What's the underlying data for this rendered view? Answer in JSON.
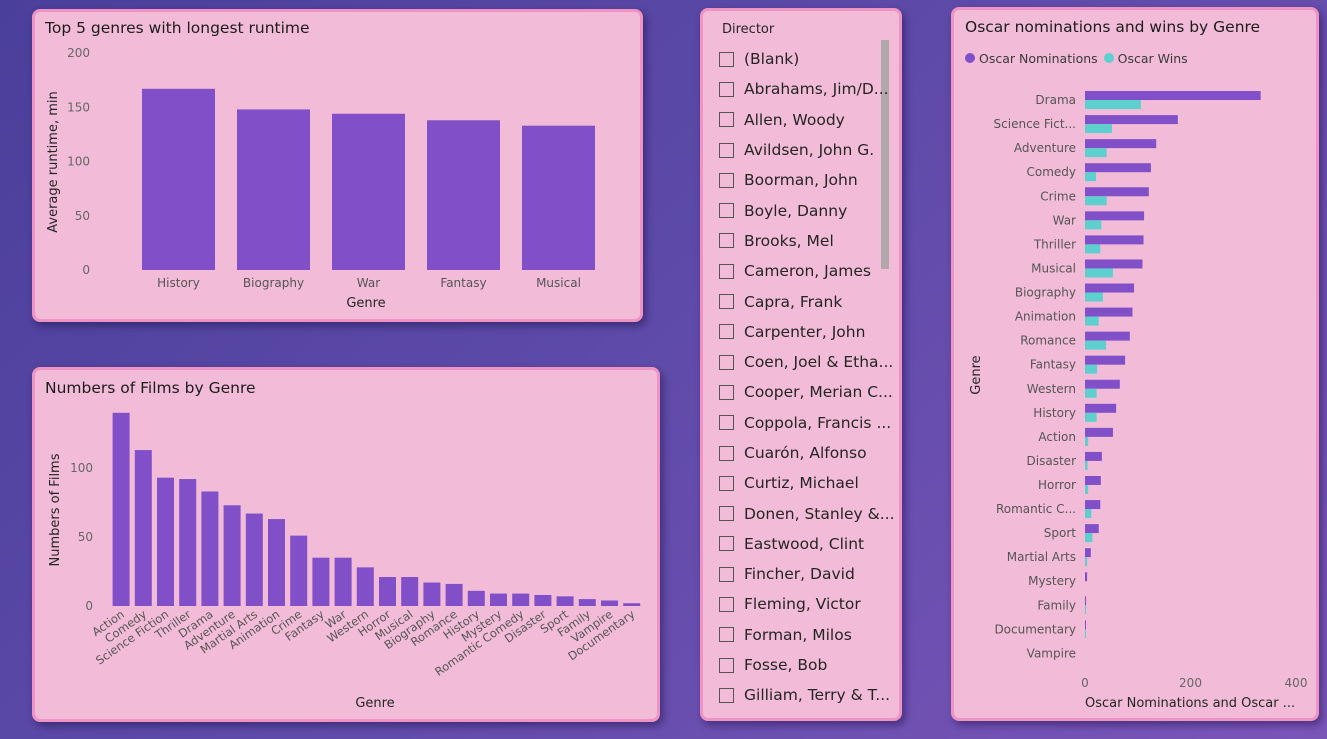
{
  "charts": {
    "runtime": {
      "title": "Top 5 genres with longest runtime",
      "xlabel": "Genre",
      "ylabel": "Average runtime, min",
      "ticks": [
        "0",
        "50",
        "100",
        "150",
        "200"
      ]
    },
    "films": {
      "title": "Numbers of Films by Genre",
      "xlabel": "Genre",
      "ylabel": "Numbers of Films",
      "ticks": [
        "0",
        "50",
        "100"
      ]
    },
    "oscar": {
      "title": "Oscar nominations and wins by Genre",
      "ylabel": "Genre",
      "xlabel": "Oscar Nominations and Oscar ...",
      "ticks": [
        "0",
        "200",
        "400"
      ],
      "legend": [
        "Oscar Nominations",
        "Oscar Wins"
      ]
    }
  },
  "chart_data": [
    {
      "type": "bar",
      "title": "Top 5 genres with longest runtime",
      "xlabel": "Genre",
      "ylabel": "Average runtime, min",
      "categories": [
        "History",
        "Biography",
        "War",
        "Fantasy",
        "Musical"
      ],
      "values": [
        167,
        148,
        144,
        138,
        133
      ],
      "ylim": [
        0,
        200
      ],
      "color": "#8150c8"
    },
    {
      "type": "bar",
      "title": "Numbers of Films by Genre",
      "xlabel": "Genre",
      "ylabel": "Numbers of Films",
      "categories": [
        "Action",
        "Comedy",
        "Science Fiction",
        "Thriller",
        "Drama",
        "Adventure",
        "Martial Arts",
        "Animation",
        "Crime",
        "Fantasy",
        "War",
        "Western",
        "Horror",
        "Musical",
        "Biography",
        "Romance",
        "History",
        "Mystery",
        "Romantic Comedy",
        "Disaster",
        "Sport",
        "Family",
        "Vampire",
        "Documentary"
      ],
      "values": [
        140,
        113,
        93,
        92,
        83,
        73,
        67,
        63,
        51,
        35,
        35,
        28,
        21,
        21,
        17,
        16,
        11,
        9,
        9,
        8,
        7,
        5,
        4,
        2
      ],
      "ylim": [
        0,
        140
      ],
      "color": "#8150c8"
    },
    {
      "type": "bar",
      "orientation": "horizontal",
      "title": "Oscar nominations and wins by Genre",
      "ylabel": "Genre",
      "xlabel": "Oscar Nominations and Oscar ...",
      "categories": [
        "Drama",
        "Science Fict...",
        "Adventure",
        "Comedy",
        "Crime",
        "War",
        "Thriller",
        "Musical",
        "Biography",
        "Animation",
        "Romance",
        "Fantasy",
        "Western",
        "History",
        "Action",
        "Disaster",
        "Horror",
        "Romantic C...",
        "Sport",
        "Martial Arts",
        "Mystery",
        "Family",
        "Documentary",
        "Vampire"
      ],
      "series": [
        {
          "name": "Oscar Nominations",
          "color": "#8150c8",
          "values": [
            333,
            176,
            135,
            125,
            121,
            112,
            111,
            109,
            93,
            90,
            85,
            76,
            66,
            59,
            53,
            32,
            30,
            29,
            26,
            11,
            4,
            2,
            1,
            0
          ]
        },
        {
          "name": "Oscar Wins",
          "color": "#5ecfcf",
          "values": [
            106,
            51,
            41,
            21,
            41,
            31,
            29,
            53,
            34,
            26,
            40,
            23,
            22,
            22,
            6,
            5,
            6,
            12,
            14,
            4,
            0,
            1,
            1,
            0
          ]
        }
      ],
      "xlim": [
        0,
        420
      ]
    }
  ],
  "slicer": {
    "title": "Director",
    "items": [
      "(Blank)",
      "Abrahams, Jim/D...",
      "Allen, Woody",
      "Avildsen, John G.",
      "Boorman, John",
      "Boyle, Danny",
      "Brooks, Mel",
      "Cameron, James",
      "Capra, Frank",
      "Carpenter, John",
      "Coen, Joel & Etha...",
      "Cooper, Merian C...",
      "Coppola, Francis ...",
      "Cuarón, Alfonso",
      "Curtiz, Michael",
      "Donen, Stanley &...",
      "Eastwood, Clint",
      "Fincher, David",
      "Fleming, Victor",
      "Forman, Milos",
      "Fosse, Bob",
      "Gilliam, Terry & T..."
    ]
  }
}
